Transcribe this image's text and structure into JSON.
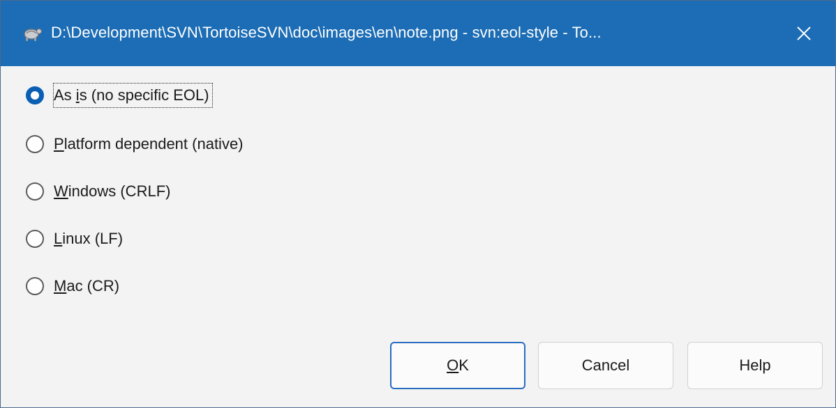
{
  "window": {
    "title": "D:\\Development\\SVN\\TortoiseSVN\\doc\\images\\en\\note.png - svn:eol-style - To...",
    "app_icon": "tortoise-icon",
    "close_icon": "close-icon",
    "accent_color": "#1c6db5"
  },
  "options": [
    {
      "pre": "As ",
      "mnemonic": "i",
      "post": "s (no specific EOL)",
      "checked": true
    },
    {
      "pre": "",
      "mnemonic": "P",
      "post": "latform dependent (native)",
      "checked": false
    },
    {
      "pre": "",
      "mnemonic": "W",
      "post": "indows (CRLF)",
      "checked": false
    },
    {
      "pre": "",
      "mnemonic": "L",
      "post": "inux (LF)",
      "checked": false
    },
    {
      "pre": "",
      "mnemonic": "M",
      "post": "ac (CR)",
      "checked": false
    }
  ],
  "buttons": {
    "ok": {
      "mnemonic": "O",
      "post": "K"
    },
    "cancel": {
      "label": "Cancel"
    },
    "help": {
      "label": "Help"
    }
  }
}
